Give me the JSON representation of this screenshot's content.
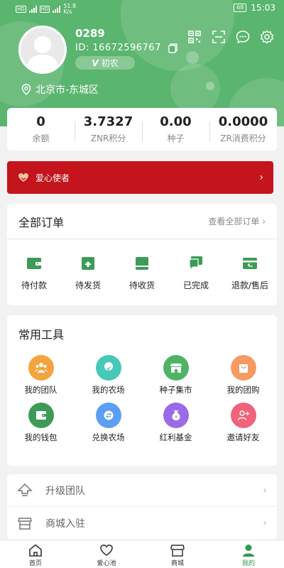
{
  "status_bar": {
    "net_speed": "51.8\nK/s",
    "battery": "68",
    "time": "15:03"
  },
  "profile": {
    "name": "0289",
    "id_label": "ID: 16672596767",
    "level": "初农",
    "level_prefix": "V",
    "location": "北京市-东城区"
  },
  "stats": [
    {
      "value": "0",
      "label": "余额"
    },
    {
      "value": "3.7327",
      "label": "ZNR积分"
    },
    {
      "value": "0.00",
      "label": "种子"
    },
    {
      "value": "0.0000",
      "label": "ZR消费积分"
    }
  ],
  "banner": {
    "label": "爱心使者"
  },
  "orders": {
    "title": "全部订单",
    "view_all": "查看全部订单",
    "items": [
      {
        "label": "待付款",
        "icon": "wallet-icon"
      },
      {
        "label": "待发货",
        "icon": "box-up-icon"
      },
      {
        "label": "待收货",
        "icon": "package-icon"
      },
      {
        "label": "已完成",
        "icon": "chat-done-icon"
      },
      {
        "label": "退款/售后",
        "icon": "refund-icon"
      }
    ]
  },
  "tools": {
    "title": "常用工具",
    "items": [
      {
        "label": "我的团队",
        "color": "#f3a43e"
      },
      {
        "label": "我的农场",
        "color": "#46c9b6"
      },
      {
        "label": "种子集市",
        "color": "#4fb365"
      },
      {
        "label": "我的团购",
        "color": "#f59a63"
      },
      {
        "label": "我的钱包",
        "color": "#3d9b57"
      },
      {
        "label": "兑换农场",
        "color": "#5b9ef2"
      },
      {
        "label": "红利基金",
        "color": "#9a6be8"
      },
      {
        "label": "邀请好友",
        "color": "#f0637a"
      }
    ]
  },
  "list": [
    {
      "label": "升级团队"
    },
    {
      "label": "商城入驻"
    }
  ],
  "bottom_nav": [
    {
      "label": "首页",
      "active": false
    },
    {
      "label": "爱心池",
      "active": false
    },
    {
      "label": "商城",
      "active": false
    },
    {
      "label": "我的",
      "active": true
    }
  ],
  "colors": {
    "header_green": "#5ab56e",
    "accent_green": "#2c9a4e",
    "banner_red": "#c4141c"
  }
}
